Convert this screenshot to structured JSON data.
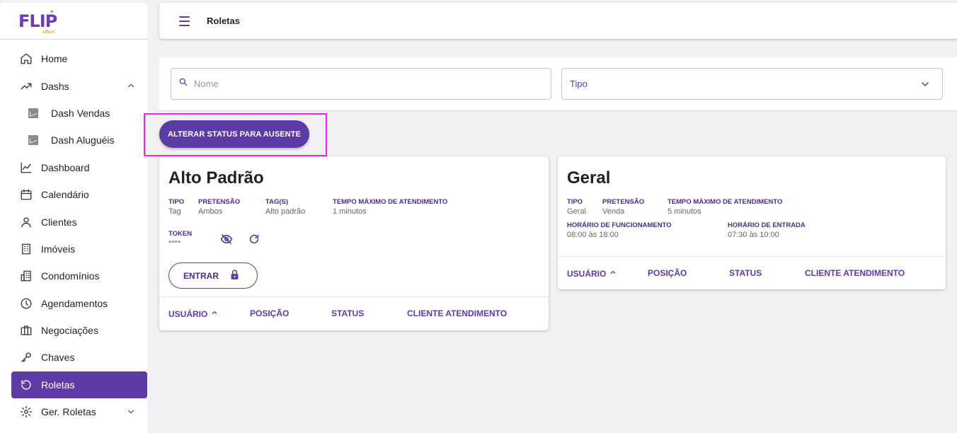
{
  "brand": {
    "name": "FLIP",
    "sub": "effect"
  },
  "sidebar": {
    "items": [
      {
        "label": "Home",
        "icon": "home-icon"
      },
      {
        "label": "Dashs",
        "icon": "trending-up-icon",
        "expanded": true
      },
      {
        "label": "Dash Vendas",
        "icon": "chart-thumbnail-icon"
      },
      {
        "label": "Dash Aluguéis",
        "icon": "chart-thumbnail-icon"
      },
      {
        "label": "Dashboard",
        "icon": "line-chart-icon"
      },
      {
        "label": "Calendário",
        "icon": "calendar-icon"
      },
      {
        "label": "Clientes",
        "icon": "user-icon"
      },
      {
        "label": "Imóveis",
        "icon": "building-icon"
      },
      {
        "label": "Condomínios",
        "icon": "apartment-icon"
      },
      {
        "label": "Agendamentos",
        "icon": "clock-icon"
      },
      {
        "label": "Negociações",
        "icon": "briefcase-icon"
      },
      {
        "label": "Chaves",
        "icon": "key-icon"
      },
      {
        "label": "Roletas",
        "icon": "rotate-icon",
        "active": true
      },
      {
        "label": "Ger. Roletas",
        "icon": "gear-icon"
      }
    ]
  },
  "header": {
    "title": "Roletas"
  },
  "filters": {
    "search_placeholder": "Nome",
    "type_placeholder": "Tipo"
  },
  "action": {
    "label": "ALTERAR STATUS PARA AUSENTE"
  },
  "cards": [
    {
      "title": "Alto Padrão",
      "fields": {
        "tipo_label": "TIPO",
        "tipo": "Tag",
        "pretensao_label": "PRETENSÃO",
        "pretensao": "Ambos",
        "tags_label": "TAG(S)",
        "tags": "Alto padrão",
        "tempo_label": "TEMPO MÁXIMO DE ATENDIMENTO",
        "tempo": "1 minutos",
        "token_label": "TOKEN",
        "token": "****"
      },
      "enter_label": "ENTRAR",
      "columns": [
        "USUÁRIO",
        "POSIÇÃO",
        "STATUS",
        "CLIENTE ATENDIMENTO"
      ]
    },
    {
      "title": "Geral",
      "fields": {
        "tipo_label": "TIPO",
        "tipo": "Geral",
        "pretensao_label": "PRETENSÃO",
        "pretensao": "Venda",
        "tempo_label": "TEMPO MÁXIMO DE ATENDIMENTO",
        "tempo": "5 minutos",
        "funcionamento_label": "HORÁRIO DE FUNCIONAMENTO",
        "funcionamento": "08:00 às 18:00",
        "entrada_label": "HORÁRIO DE ENTRADA",
        "entrada": "07:30 às 10:00"
      },
      "columns": [
        "USUÁRIO",
        "POSIÇÃO",
        "STATUS",
        "CLIENTE ATENDIMENTO"
      ]
    }
  ],
  "colors": {
    "primary": "#5b3ba6",
    "highlight": "#ff19ff"
  }
}
